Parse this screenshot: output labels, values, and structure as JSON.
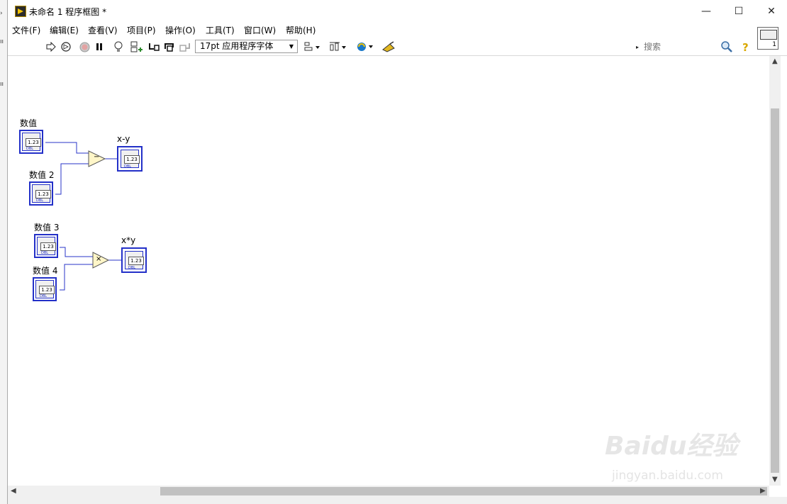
{
  "window": {
    "title": "未命名 1 程序框图 *",
    "controls": [
      "—",
      "☐",
      "✕"
    ]
  },
  "menu": [
    "文件(F)",
    "编辑(E)",
    "查看(V)",
    "项目(P)",
    "操作(O)",
    "工具(T)",
    "窗口(W)",
    "帮助(H)"
  ],
  "toolbar": {
    "font_select": "17pt 应用程序字体",
    "search_placeholder": "搜索",
    "connector_pane_number": "1"
  },
  "diagram": {
    "terminals": {
      "num1": {
        "label": "数值",
        "value": "1.23",
        "type": "DBL"
      },
      "num2": {
        "label": "数值 2",
        "value": "1.23",
        "type": "DBL"
      },
      "out1": {
        "label": "x-y",
        "value": "1.23",
        "type": "DBL"
      },
      "num3": {
        "label": "数值 3",
        "value": "1.23",
        "type": "DBL"
      },
      "num4": {
        "label": "数值 4",
        "value": "1.23",
        "type": "DBL"
      },
      "out2": {
        "label": "x*y",
        "value": "1.23",
        "type": "DBL"
      }
    },
    "nodes": {
      "subtract": "−",
      "multiply": "×"
    }
  },
  "watermark": {
    "logo": "Baidu经验",
    "url": "jingyan.baidu.com"
  },
  "colors": {
    "terminal_border": "#2330c8",
    "wire": "#2a36c8",
    "node_fill": "#fff6c8"
  }
}
